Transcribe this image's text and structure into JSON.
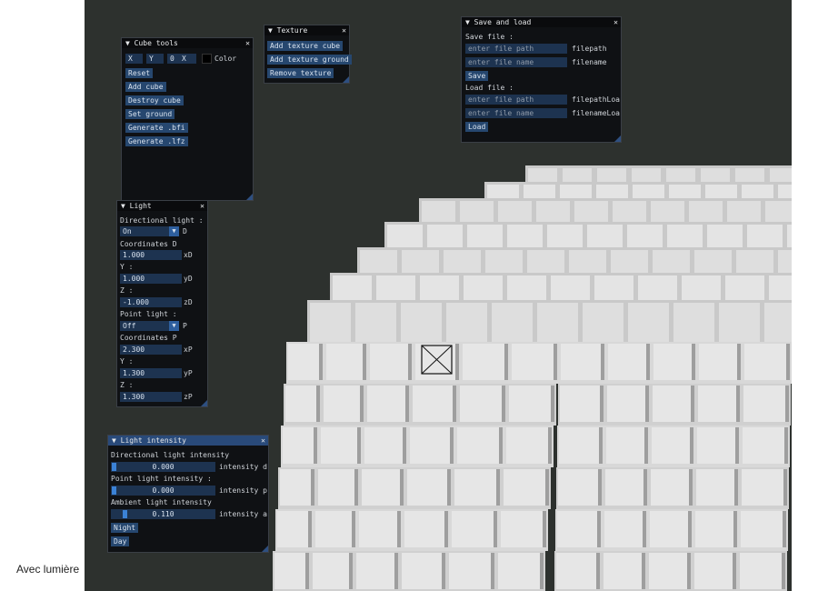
{
  "caption": "Avec lumière",
  "cube_tools": {
    "title": "Cube tools",
    "x_value": "X",
    "y_value": "Y",
    "z_value": "0",
    "w_value": "X",
    "color_label": "Color",
    "buttons": [
      "Reset",
      "Add cube",
      "Destroy cube",
      "Set ground",
      "Generate .bfi",
      "Generate .lfz"
    ]
  },
  "texture": {
    "title": "Texture",
    "buttons": [
      "Add texture cube",
      "Add texture ground",
      "Remove texture"
    ]
  },
  "save_load": {
    "title": "Save and load",
    "save_label": "Save file :",
    "save_path_placeholder": "enter file path",
    "save_path_label": "filepath",
    "save_name_placeholder": "enter file name",
    "save_name_label": "filename",
    "save_button": "Save",
    "load_label": "Load file :",
    "load_path_placeholder": "enter file path",
    "load_path_label": "filepathLoa",
    "load_name_placeholder": "enter file name",
    "load_name_label": "filenameLoa",
    "load_button": "Load"
  },
  "light": {
    "title": "Light",
    "directional_label": "Directional light :",
    "directional_value": "On",
    "directional_suffix": "D",
    "coords_label": "Coordinates D",
    "dx_value": "1.000",
    "dx_suffix": "xD",
    "y_label": "Y :",
    "dy_value": "1.000",
    "dy_suffix": "yD",
    "z_label": "Z :",
    "dz_value": "-1.000",
    "dz_suffix": "zD",
    "point_label": "Point light :",
    "point_value": "Off",
    "point_suffix": "P",
    "coords_p_label": "Coordinates P",
    "px_value": "2.300",
    "px_suffix": "xP",
    "py_label": "Y :",
    "py_value": "1.300",
    "py_suffix": "yP",
    "pz_label": "Z :",
    "pz_value": "1.300",
    "pz_suffix": "zP"
  },
  "intensity": {
    "title": "Light intensity",
    "directional_label": "Directional light intensity",
    "directional_value": "0.000",
    "directional_fraction": 0.0,
    "directional_suffix": "intensity d",
    "point_label": "Point light intensity :",
    "point_value": "0.000",
    "point_fraction": 0.0,
    "point_suffix": "intensity p",
    "ambient_label": "Ambient light intensity",
    "ambient_value": "0.110",
    "ambient_fraction": 0.11,
    "ambient_suffix": "intensity a",
    "night_button": "Night",
    "day_button": "Day"
  },
  "colors": {
    "scene_bg": "#2d312e",
    "window_bg": "#0f1114",
    "button": "#26476f",
    "accent": "#3b82d6"
  }
}
